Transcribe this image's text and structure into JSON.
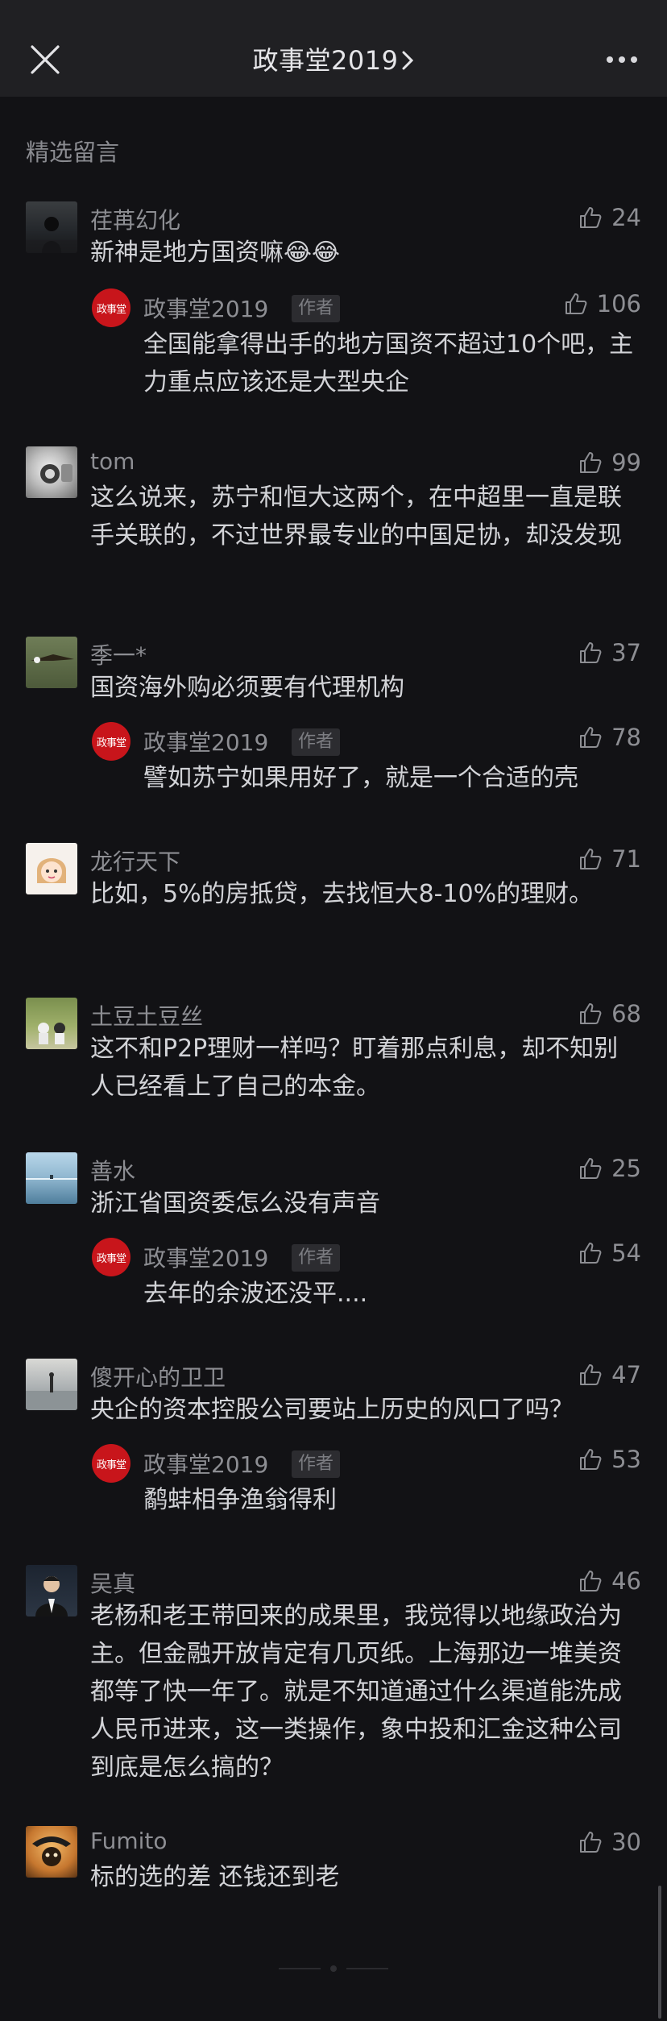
{
  "header": {
    "title": "政事堂2019",
    "close_icon": "close-icon",
    "more_icon": "more-icon"
  },
  "section_label": "精选留言",
  "comments": [
    {
      "name": "荏苒幻化",
      "likes": "24",
      "content": "新神是地方国资嘛😂😂",
      "reply": {
        "name": "政事堂2019",
        "badge": "作者",
        "likes": "106",
        "content": "全国能拿得出手的地方国资不超过10个吧，主力重点应该还是大型央企"
      }
    },
    {
      "name": "tom",
      "likes": "99",
      "content": "这么说来，苏宁和恒大这两个，在中超里一直是联手关联的，不过世界最专业的中国足协，却没发现"
    },
    {
      "name": "季一*",
      "likes": "37",
      "content": "国资海外购必须要有代理机构",
      "reply": {
        "name": "政事堂2019",
        "badge": "作者",
        "likes": "78",
        "content": "譬如苏宁如果用好了，就是一个合适的壳"
      }
    },
    {
      "name": "龙行天下",
      "likes": "71",
      "content": "比如，5%的房抵贷，去找恒大8-10%的理财。"
    },
    {
      "name": "土豆土豆丝",
      "likes": "68",
      "content": "这不和P2P理财一样吗？盯着那点利息，却不知别人已经看上了自己的本金。"
    },
    {
      "name": "善水",
      "likes": "25",
      "content": "浙江省国资委怎么没有声音",
      "reply": {
        "name": "政事堂2019",
        "badge": "作者",
        "likes": "54",
        "content": "去年的余波还没平...."
      }
    },
    {
      "name": "傻开心的卫卫",
      "likes": "47",
      "content": "央企的资本控股公司要站上历史的风口了吗？",
      "reply": {
        "name": "政事堂2019",
        "badge": "作者",
        "likes": "53",
        "content": "鹬蚌相争渔翁得利"
      }
    },
    {
      "name": "吴真",
      "likes": "46",
      "content": "老杨和老王带回来的成果里，我觉得以地缘政治为主。但金融开放肯定有几页纸。上海那边一堆美资都等了快一年了。就是不知道通过什么渠道能洗成人民币进来，这一类操作，象中投和汇金这种公司到底是怎么搞的？"
    },
    {
      "name": "Fumito",
      "likes": "30",
      "content": "标的选的差 还钱还到老"
    }
  ],
  "icons": {
    "like": "thumbs-up-icon",
    "seal": "author-seal-icon"
  },
  "colors": {
    "background": "#121215",
    "header": "#202023",
    "author_seal": "#c8151b"
  }
}
